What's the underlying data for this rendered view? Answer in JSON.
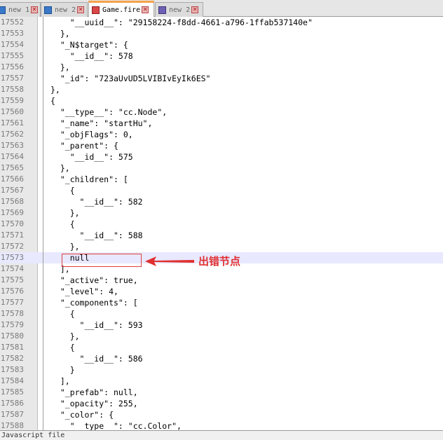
{
  "tabs": [
    {
      "label": "new 1",
      "icon": "blue",
      "active": false
    },
    {
      "label": "new 2",
      "icon": "blue",
      "active": false
    },
    {
      "label": "Game.fire",
      "icon": "red",
      "active": true
    },
    {
      "label": "new 2",
      "icon": "purple",
      "active": false
    }
  ],
  "lines": [
    {
      "num": "17552",
      "code": "    \"__uuid__\": \"29158224-f8dd-4661-a796-1ffab537140e\""
    },
    {
      "num": "17553",
      "code": "  },"
    },
    {
      "num": "17554",
      "code": "  \"_N$target\": {"
    },
    {
      "num": "17555",
      "code": "    \"__id__\": 578"
    },
    {
      "num": "17556",
      "code": "  },"
    },
    {
      "num": "17557",
      "code": "  \"_id\": \"723aUvUD5LVIBIvEyIk6ES\""
    },
    {
      "num": "17558",
      "code": "},"
    },
    {
      "num": "17559",
      "code": "{"
    },
    {
      "num": "17560",
      "code": "  \"__type__\": \"cc.Node\","
    },
    {
      "num": "17561",
      "code": "  \"_name\": \"startHu\","
    },
    {
      "num": "17562",
      "code": "  \"_objFlags\": 0,"
    },
    {
      "num": "17563",
      "code": "  \"_parent\": {"
    },
    {
      "num": "17564",
      "code": "    \"__id__\": 575"
    },
    {
      "num": "17565",
      "code": "  },"
    },
    {
      "num": "17566",
      "code": "  \"_children\": ["
    },
    {
      "num": "17567",
      "code": "    {"
    },
    {
      "num": "17568",
      "code": "      \"__id__\": 582"
    },
    {
      "num": "17569",
      "code": "    },"
    },
    {
      "num": "17570",
      "code": "    {"
    },
    {
      "num": "17571",
      "code": "      \"__id__\": 588"
    },
    {
      "num": "17572",
      "code": "    },"
    },
    {
      "num": "17573",
      "code": "    null"
    },
    {
      "num": "17574",
      "code": "  ],"
    },
    {
      "num": "17575",
      "code": "  \"_active\": true,"
    },
    {
      "num": "17576",
      "code": "  \"_level\": 4,"
    },
    {
      "num": "17577",
      "code": "  \"_components\": ["
    },
    {
      "num": "17578",
      "code": "    {"
    },
    {
      "num": "17579",
      "code": "      \"__id__\": 593"
    },
    {
      "num": "17580",
      "code": "    },"
    },
    {
      "num": "17581",
      "code": "    {"
    },
    {
      "num": "17582",
      "code": "      \"__id__\": 586"
    },
    {
      "num": "17583",
      "code": "    }"
    },
    {
      "num": "17584",
      "code": "  ],"
    },
    {
      "num": "17585",
      "code": "  \"_prefab\": null,"
    },
    {
      "num": "17586",
      "code": "  \"_opacity\": 255,"
    },
    {
      "num": "17587",
      "code": "  \"_color\": {"
    },
    {
      "num": "17588",
      "code": "    \"__type__\": \"cc.Color\","
    }
  ],
  "annotation": {
    "label": "出错节点",
    "color": "#e03030"
  },
  "status": {
    "text": "Javascript file"
  },
  "colors": {
    "highlight": "#e8e8ff",
    "accent_tab": "#f6a24a"
  }
}
